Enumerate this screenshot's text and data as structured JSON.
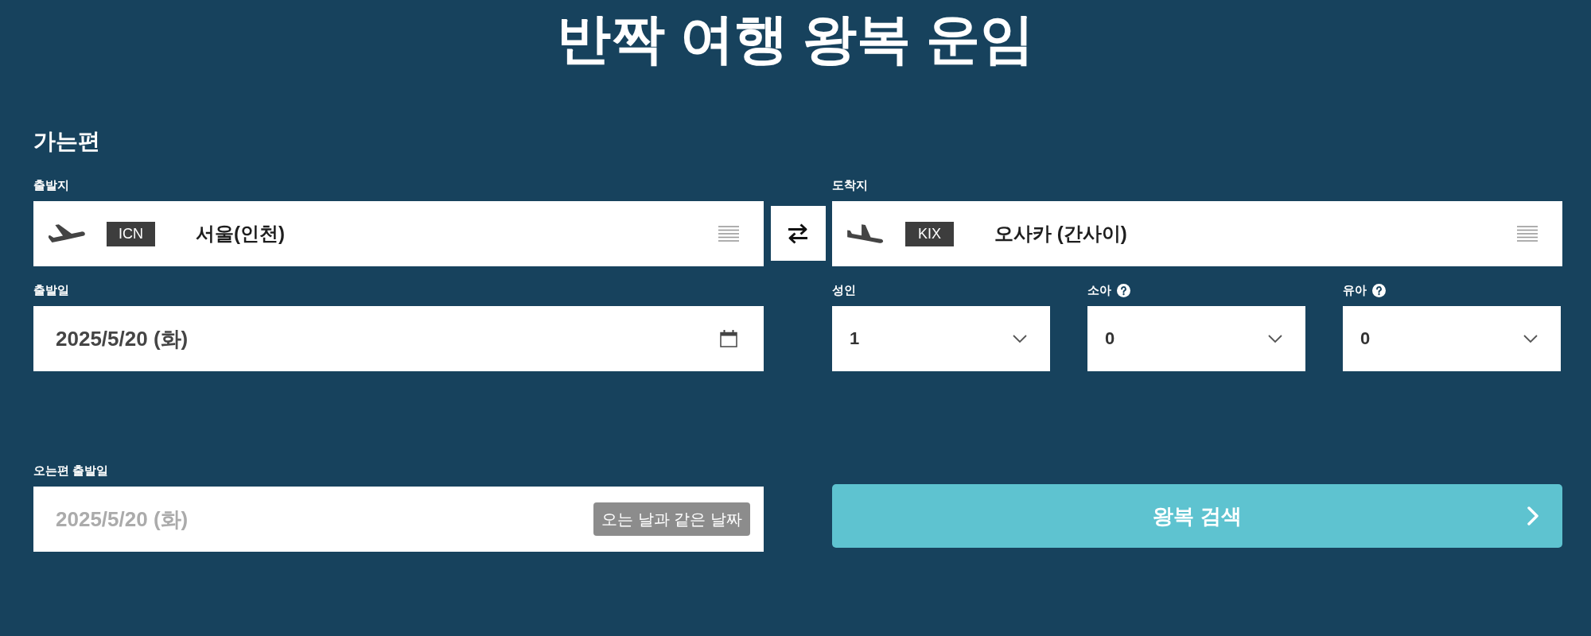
{
  "title": "반짝 여행 왕복 운임",
  "outbound": {
    "heading": "가는편",
    "origin": {
      "label": "출발지",
      "code": "ICN",
      "city": "서울(인천)"
    },
    "destination": {
      "label": "도착지",
      "code": "KIX",
      "city": "오사카 (간사이)"
    },
    "departure_date": {
      "label": "출발일",
      "value": "2025/5/20 (화)"
    },
    "passengers": [
      {
        "label": "성인",
        "value": "1",
        "help": false
      },
      {
        "label": "소아",
        "value": "0",
        "help": true
      },
      {
        "label": "유아",
        "value": "0",
        "help": true
      }
    ]
  },
  "return": {
    "label": "오는편 출발일",
    "placeholder": "2025/5/20 (화)",
    "same_day_button": "오는 날과 같은 날짜"
  },
  "search_button": "왕복 검색"
}
